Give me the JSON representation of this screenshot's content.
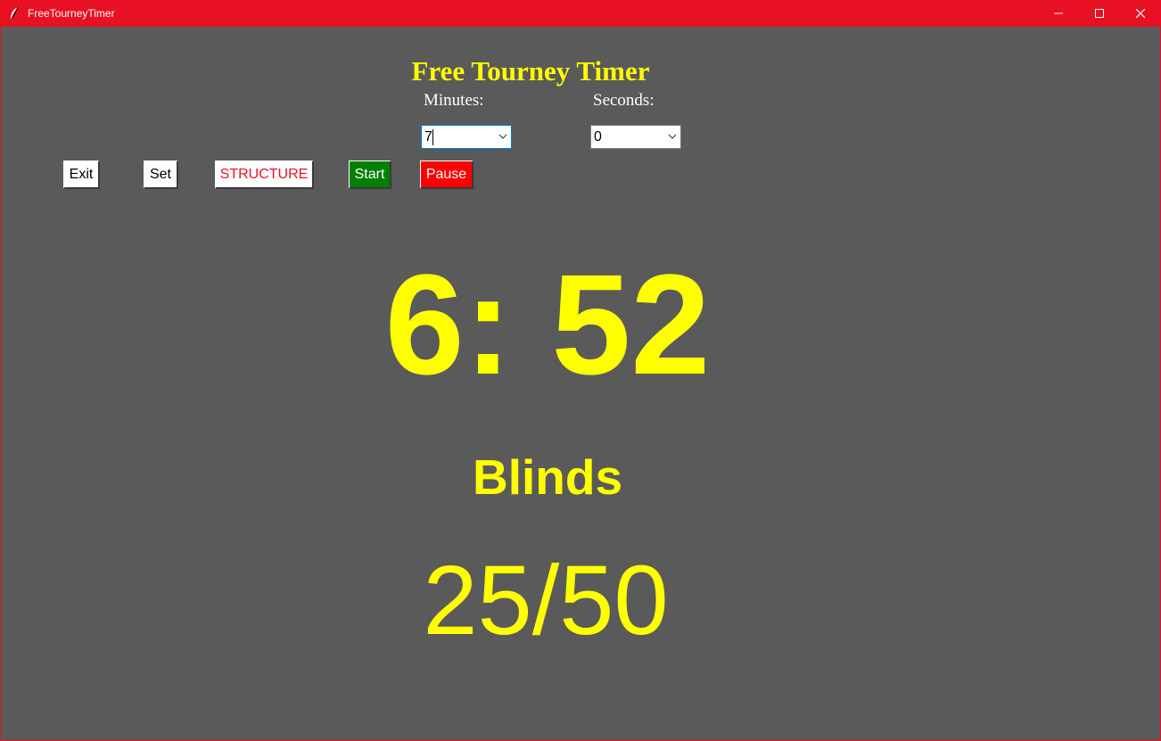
{
  "window": {
    "title": "FreeTourneyTimer",
    "icon": "feather-icon",
    "titlebar_color": "#e81123",
    "background_color": "#5a5a5a",
    "controls": [
      "minimize-icon",
      "maximize-icon",
      "close-icon"
    ]
  },
  "header": {
    "title": "Free Tourney Timer",
    "accent_color": "#ffff00"
  },
  "minutes": {
    "label": "Minutes:",
    "value": "7"
  },
  "seconds": {
    "label": "Seconds:",
    "value": "0"
  },
  "toolbar": {
    "exit_label": "Exit",
    "set_label": "Set",
    "structure_label": "STRUCTURE",
    "start_label": "Start",
    "pause_label": "Pause",
    "start_color": "#008000",
    "pause_color": "#ff0000",
    "structure_text_color": "#e81123"
  },
  "timer": {
    "display": "6: 52"
  },
  "blinds": {
    "label": "Blinds",
    "value": "25/50"
  }
}
